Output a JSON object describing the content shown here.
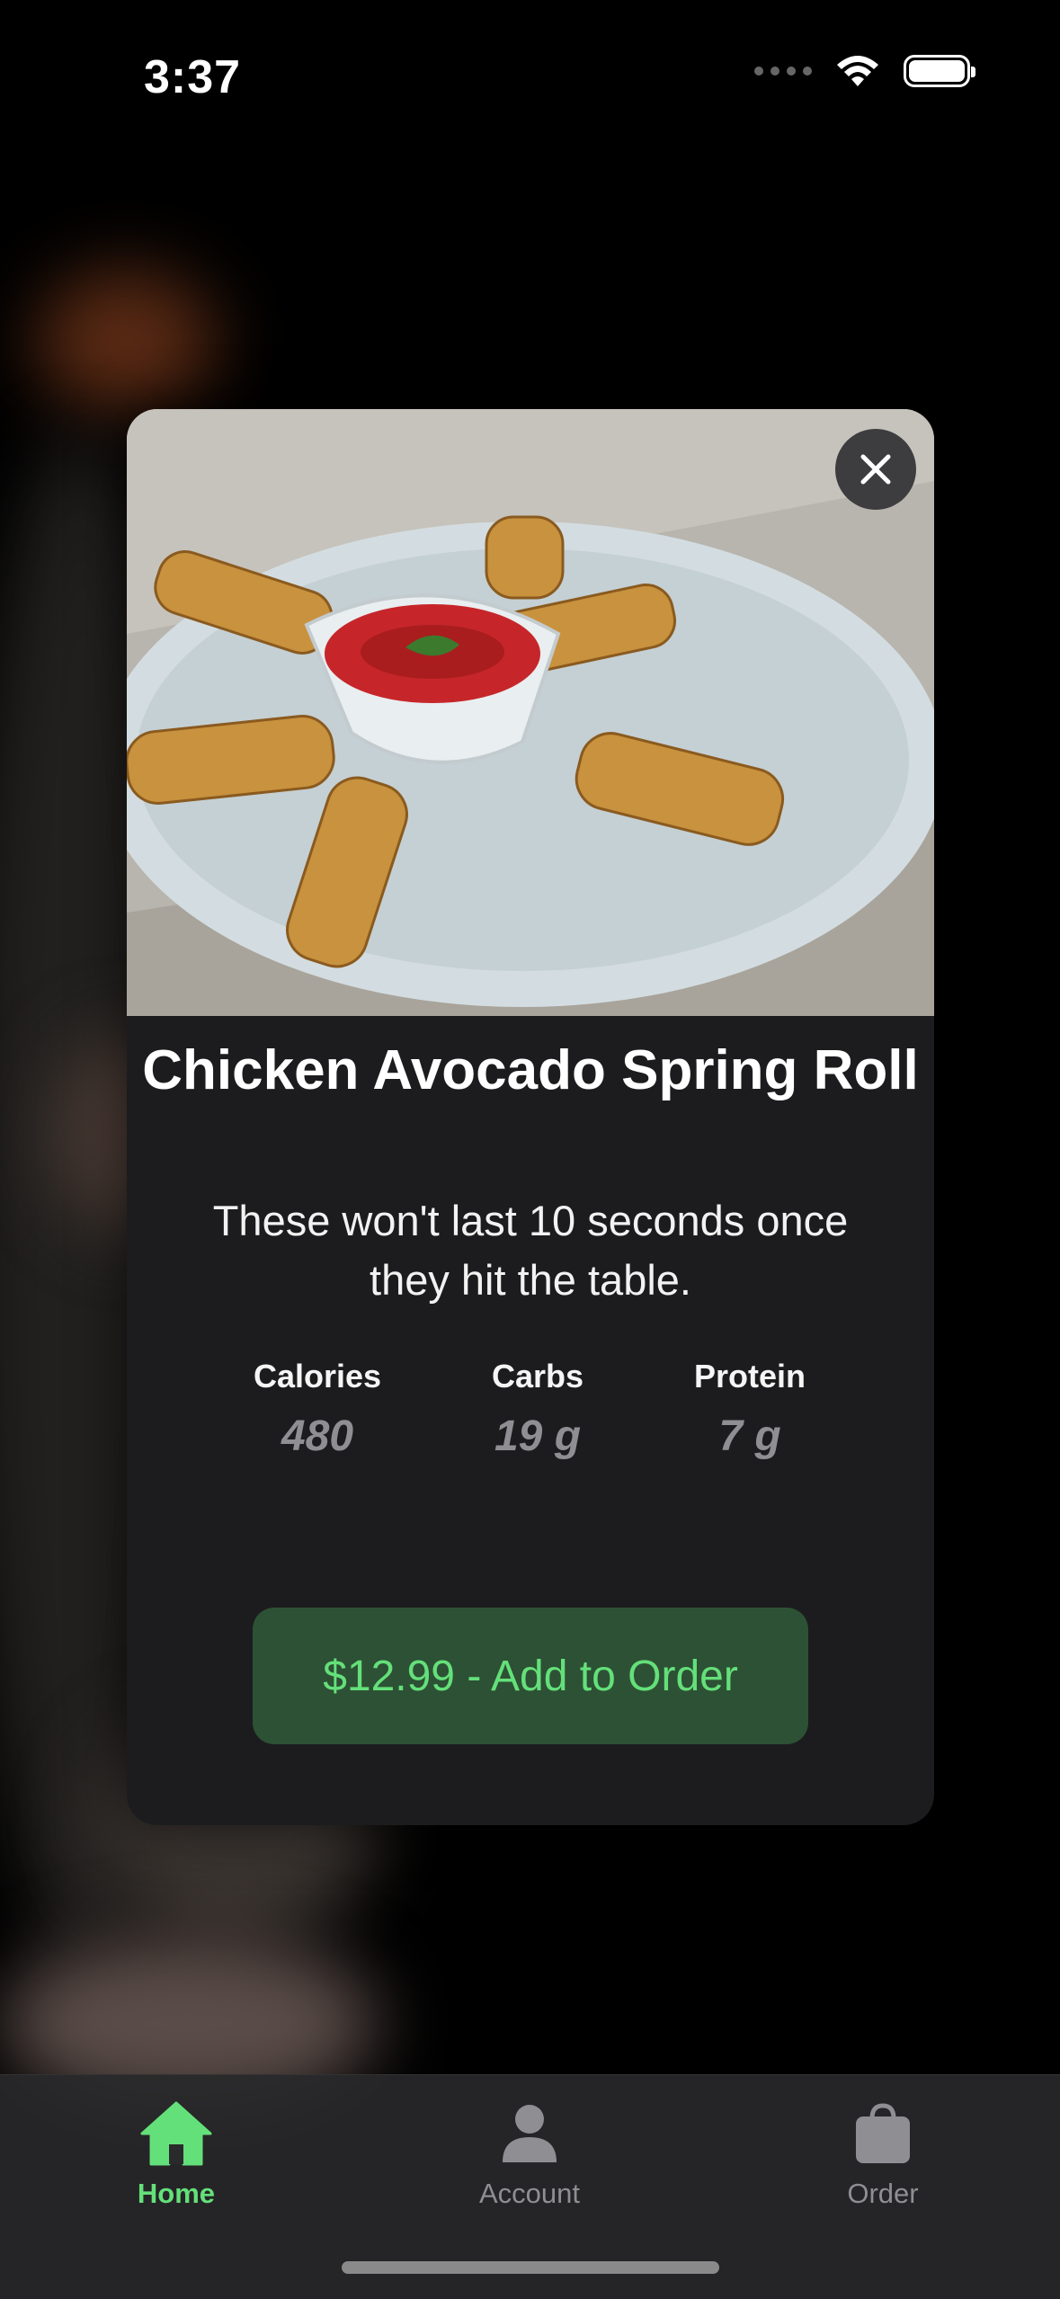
{
  "status_bar": {
    "time": "3:37"
  },
  "item": {
    "title": "Chicken Avocado Spring Roll",
    "description": "These won't last 10 seconds once they hit the table.",
    "nutrition": [
      {
        "label": "Calories",
        "value": "480"
      },
      {
        "label": "Carbs",
        "value": "19 g"
      },
      {
        "label": "Protein",
        "value": "7 g"
      }
    ],
    "add_button_label": "$12.99 - Add to Order"
  },
  "tabs": [
    {
      "label": "Home",
      "icon": "home-icon",
      "active": true
    },
    {
      "label": "Account",
      "icon": "person-icon",
      "active": false
    },
    {
      "label": "Order",
      "icon": "bag-icon",
      "active": false
    }
  ],
  "colors": {
    "accent": "#64e07a",
    "button_bg": "#2d5134",
    "card_bg": "#1c1c1e",
    "inactive": "#8e8e93"
  }
}
